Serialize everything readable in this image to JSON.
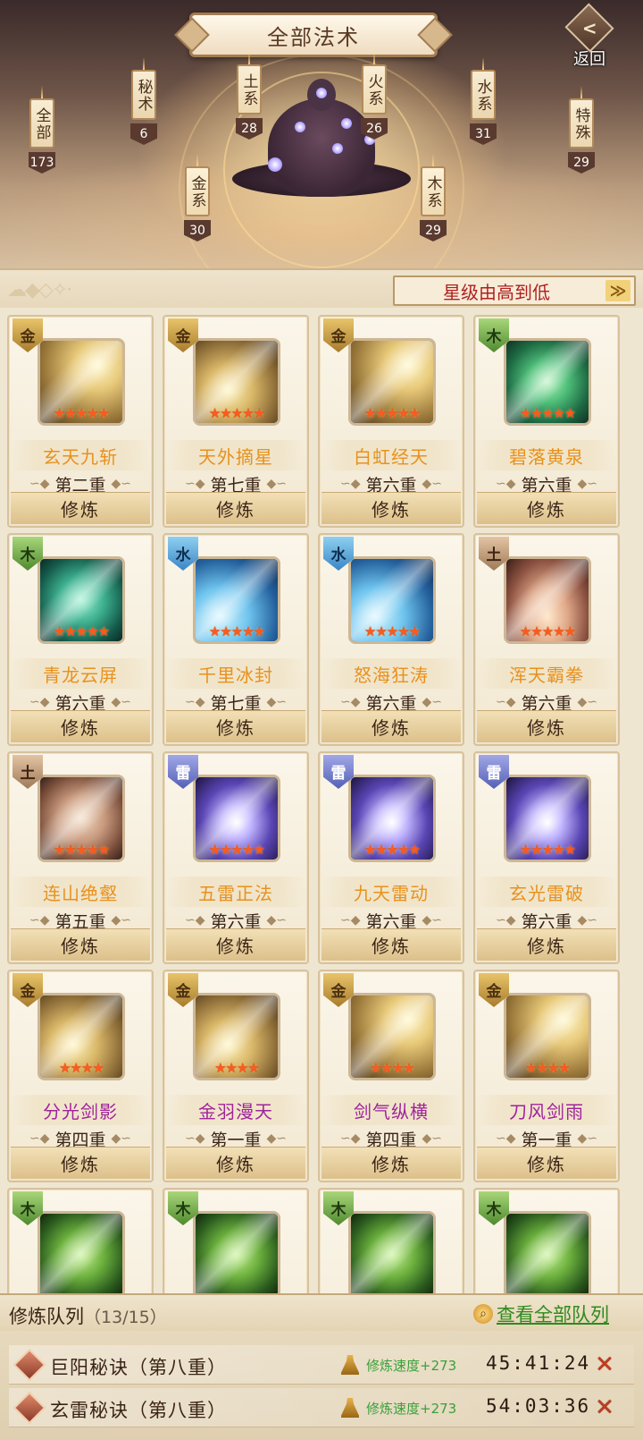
{
  "header": {
    "title": "全部法术",
    "back_label": "返回",
    "categories": [
      {
        "name": "全部",
        "count": "173"
      },
      {
        "name": "秘术",
        "count": "6"
      },
      {
        "name": "土系",
        "count": "28"
      },
      {
        "name": "火系",
        "count": "26"
      },
      {
        "name": "水系",
        "count": "31"
      },
      {
        "name": "特殊",
        "count": "29"
      },
      {
        "name": "金系",
        "count": "30"
      },
      {
        "name": "木系",
        "count": "29"
      }
    ]
  },
  "sort": {
    "label": "星级由高到低",
    "arrow": "≫"
  },
  "cards": [
    {
      "element": "金",
      "name": "玄天九斩",
      "level": "第二重",
      "stars": 5,
      "button": "修炼"
    },
    {
      "element": "金",
      "name": "天外摘星",
      "level": "第七重",
      "stars": 5,
      "button": "修炼"
    },
    {
      "element": "金",
      "name": "白虹经天",
      "level": "第六重",
      "stars": 5,
      "button": "修炼"
    },
    {
      "element": "木",
      "name": "碧落黄泉",
      "level": "第六重",
      "stars": 5,
      "button": "修炼"
    },
    {
      "element": "木",
      "name": "青龙云屏",
      "level": "第六重",
      "stars": 5,
      "button": "修炼"
    },
    {
      "element": "水",
      "name": "千里冰封",
      "level": "第七重",
      "stars": 5,
      "button": "修炼"
    },
    {
      "element": "水",
      "name": "怒海狂涛",
      "level": "第六重",
      "stars": 5,
      "button": "修炼"
    },
    {
      "element": "土",
      "name": "浑天霸拳",
      "level": "第六重",
      "stars": 5,
      "button": "修炼"
    },
    {
      "element": "土",
      "name": "连山绝壑",
      "level": "第五重",
      "stars": 5,
      "button": "修炼"
    },
    {
      "element": "雷",
      "name": "五雷正法",
      "level": "第六重",
      "stars": 5,
      "button": "修炼"
    },
    {
      "element": "雷",
      "name": "九天雷动",
      "level": "第六重",
      "stars": 5,
      "button": "修炼"
    },
    {
      "element": "雷",
      "name": "玄光雷破",
      "level": "第六重",
      "stars": 5,
      "button": "修炼"
    },
    {
      "element": "金",
      "name": "分光剑影",
      "level": "第四重",
      "stars": 4,
      "button": "修炼"
    },
    {
      "element": "金",
      "name": "金羽漫天",
      "level": "第一重",
      "stars": 4,
      "button": "修炼"
    },
    {
      "element": "金",
      "name": "剑气纵横",
      "level": "第四重",
      "stars": 4,
      "button": "修炼"
    },
    {
      "element": "金",
      "name": "刀风剑雨",
      "level": "第一重",
      "stars": 4,
      "button": "修炼"
    },
    {
      "element": "木"
    },
    {
      "element": "木"
    },
    {
      "element": "木"
    },
    {
      "element": "木"
    }
  ],
  "queue": {
    "title": "修炼队列",
    "count": "（13/15）",
    "view_all": "查看全部队列",
    "items": [
      {
        "name": "巨阳秘诀（第八重）",
        "speed": "修炼速度+273",
        "time": "45:41:24"
      },
      {
        "name": "玄雷秘诀（第八重）",
        "speed": "修炼速度+273",
        "time": "54:03:36"
      }
    ]
  }
}
